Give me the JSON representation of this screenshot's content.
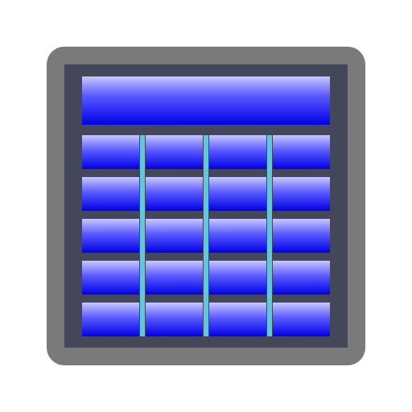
{
  "icon": {
    "name": "table-grid-icon",
    "rows": 5,
    "columns": 4,
    "colors": {
      "background": "#ffffff",
      "frame": "#7a7a7a",
      "inner_frame": "#44465a",
      "cell_top": "#c8c8ff",
      "cell_mid": "#5a5aff",
      "cell_bottom": "#0000e6",
      "column_divider": "#60c8d8"
    }
  }
}
